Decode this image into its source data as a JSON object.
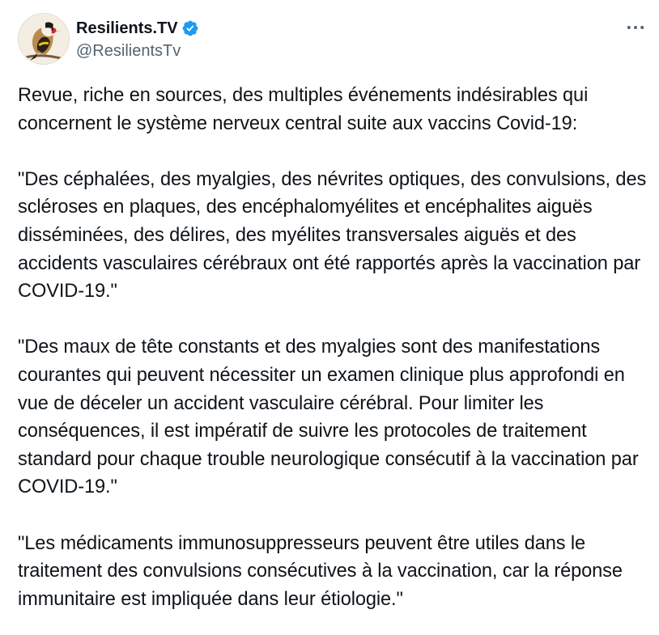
{
  "author": {
    "display_name": "Resilients.TV",
    "handle": "@ResilientsTv",
    "verified": true,
    "accent_color": "#1d9bf0"
  },
  "icons": {
    "verified": "verified-badge-icon",
    "more": "more-options-icon",
    "avatar": "goldfinch-bird-avatar"
  },
  "tweet": {
    "paragraphs": [
      "Revue, riche en sources, des multiples événements indésirables qui concernent le système nerveux central suite aux vaccins Covid-19:",
      "\"Des céphalées, des myalgies, des névrites optiques, des convulsions, des scléroses en plaques, des encéphalomyélites et encéphalites aiguës disséminées, des délires, des myélites transversales aiguës et des accidents vasculaires cérébraux ont été rapportés après la vaccination par COVID-19.\"",
      "\"Des maux de tête constants et des myalgies sont des manifestations courantes qui peuvent nécessiter un examen clinique plus approfondi en vue de déceler un accident vasculaire cérébral. Pour limiter les conséquences, il est impératif de suivre les protocoles de traitement standard pour chaque trouble neurologique consécutif à la vaccination par COVID-19.\"",
      "\"Les médicaments immunosuppresseurs peuvent être utiles dans le traitement des convulsions consécutives à la vaccination, car la réponse immunitaire est impliquée dans leur étiologie.\""
    ]
  }
}
